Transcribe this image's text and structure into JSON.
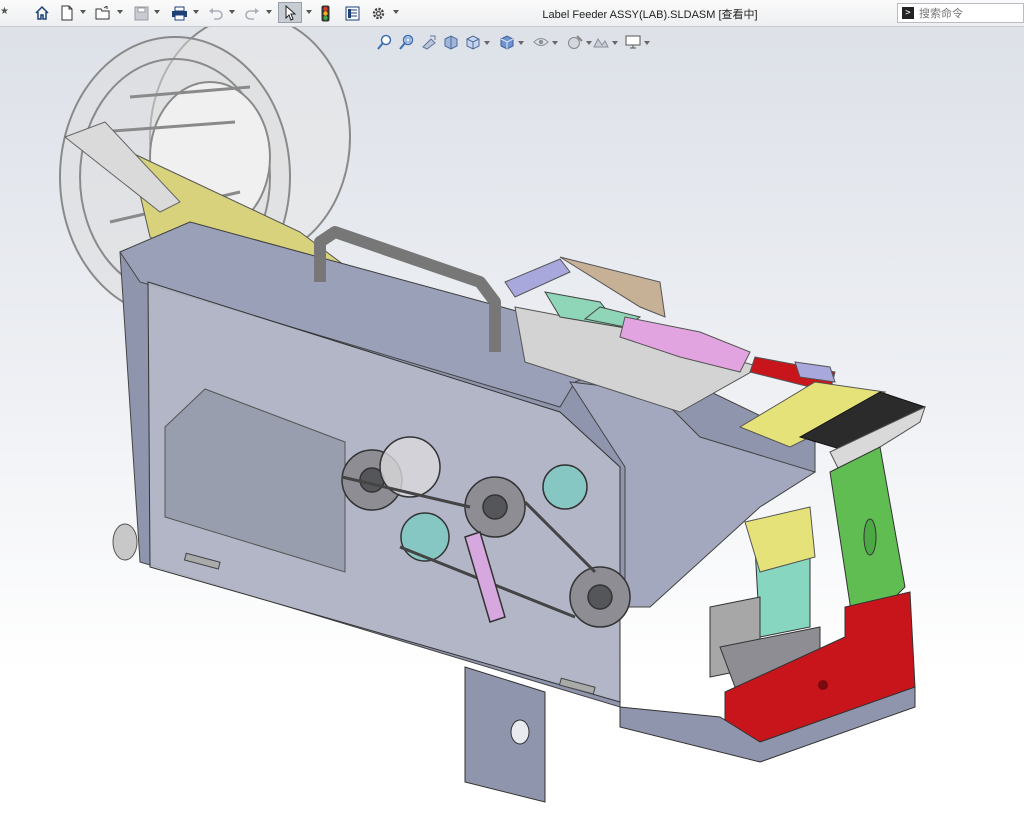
{
  "toolbar": {
    "items": [
      {
        "name": "home-icon",
        "has_dropdown": false
      },
      {
        "name": "new-document-icon",
        "has_dropdown": true
      },
      {
        "name": "open-folder-icon",
        "has_dropdown": true
      },
      {
        "name": "save-icon",
        "has_dropdown": true
      },
      {
        "name": "print-icon",
        "has_dropdown": true
      },
      {
        "name": "undo-icon",
        "has_dropdown": true
      },
      {
        "name": "redo-icon",
        "has_dropdown": true
      },
      {
        "name": "select-pointer-icon",
        "has_dropdown": true
      },
      {
        "name": "traffic-light-icon",
        "has_dropdown": false
      },
      {
        "name": "file-properties-icon",
        "has_dropdown": false
      },
      {
        "name": "options-gear-icon",
        "has_dropdown": true
      }
    ],
    "document_title": "Label Feeder ASSY(LAB).SLDASM [查看中]",
    "search_placeholder": "搜索命令"
  },
  "heads_up_toolbar": {
    "items": [
      "zoom-to-fit-icon",
      "zoom-to-area-icon",
      "previous-view-icon",
      "section-view-icon",
      "view-orientation-icon",
      "display-style-icon",
      "hide-show-items-icon",
      "edit-appearance-icon",
      "apply-scene-icon",
      "view-settings-icon"
    ]
  },
  "viewport": {
    "model": "Label Feeder ASSY",
    "colors": {
      "frame": "#8f95ad",
      "frame_dark": "#6f7690",
      "glass": "#b8bccb",
      "red_block": "#c8141b",
      "green_plate": "#5fbd52",
      "yellow_plate": "#e6e27a",
      "pink_block": "#e2a4e0",
      "teal_block": "#86d6c0",
      "reel": "#c8c8c8"
    }
  }
}
